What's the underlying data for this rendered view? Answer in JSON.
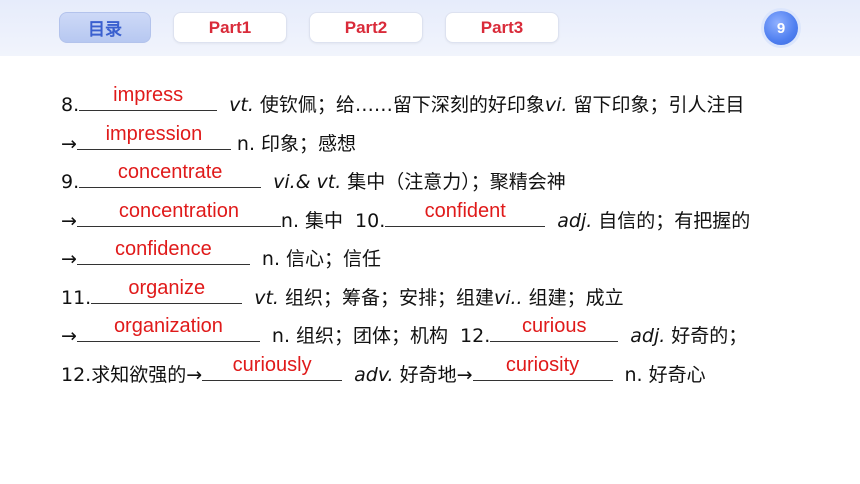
{
  "nav": {
    "home": "目录",
    "part1": "Part1",
    "part2": "Part2",
    "part3": "Part3",
    "page_number": "9"
  },
  "lines": [
    {
      "pre": "8.",
      "ans": "impress",
      "pos": "vt.",
      "def": "使钦佩；给……留下深刻的好印象",
      "pos2": "vi.",
      "def2": "留下印象；引人注目"
    },
    {
      "pre": "→",
      "ans": "impression",
      "pos": "n.",
      "def": "印象；感想"
    },
    {
      "pre": "9.",
      "ans": "concentrate",
      "pos": "vi.&",
      "pos_b": "vt.",
      "def": "集中（注意力）；聚精会神"
    },
    {
      "pre": "→",
      "ans": "concentration",
      "def": "n. 集中",
      "num": "10.",
      "ans2": "confident",
      "pos2": "adj.",
      "def2": "自信的；有把握的"
    },
    {
      "pre": "→",
      "ans": "confidence",
      "def": "n. 信心；信任"
    },
    {
      "pre": "11.",
      "ans": "organize",
      "pos": "vt.",
      "def": "组织；筹备；安排；组建",
      "pos2": "vi..",
      "def2": "组建；成立"
    },
    {
      "pre": "→",
      "ans": "organization",
      "def": "n. 组织；团体；机构",
      "num": "12.",
      "ans2": "curious",
      "pos2": "adj.",
      "def2": "好奇的；"
    },
    {
      "pre": "12.求知欲强的→",
      "ans": "curiously",
      "pos": "adv.",
      "def": "好奇地→",
      "ans2": "curiosity",
      "def2": "n. 好奇心"
    }
  ],
  "colors": {
    "answer": "#e01a1a",
    "tab_text": "#d92b3a",
    "home_text": "#3a5fcf",
    "badge": "#4f7ff0"
  }
}
